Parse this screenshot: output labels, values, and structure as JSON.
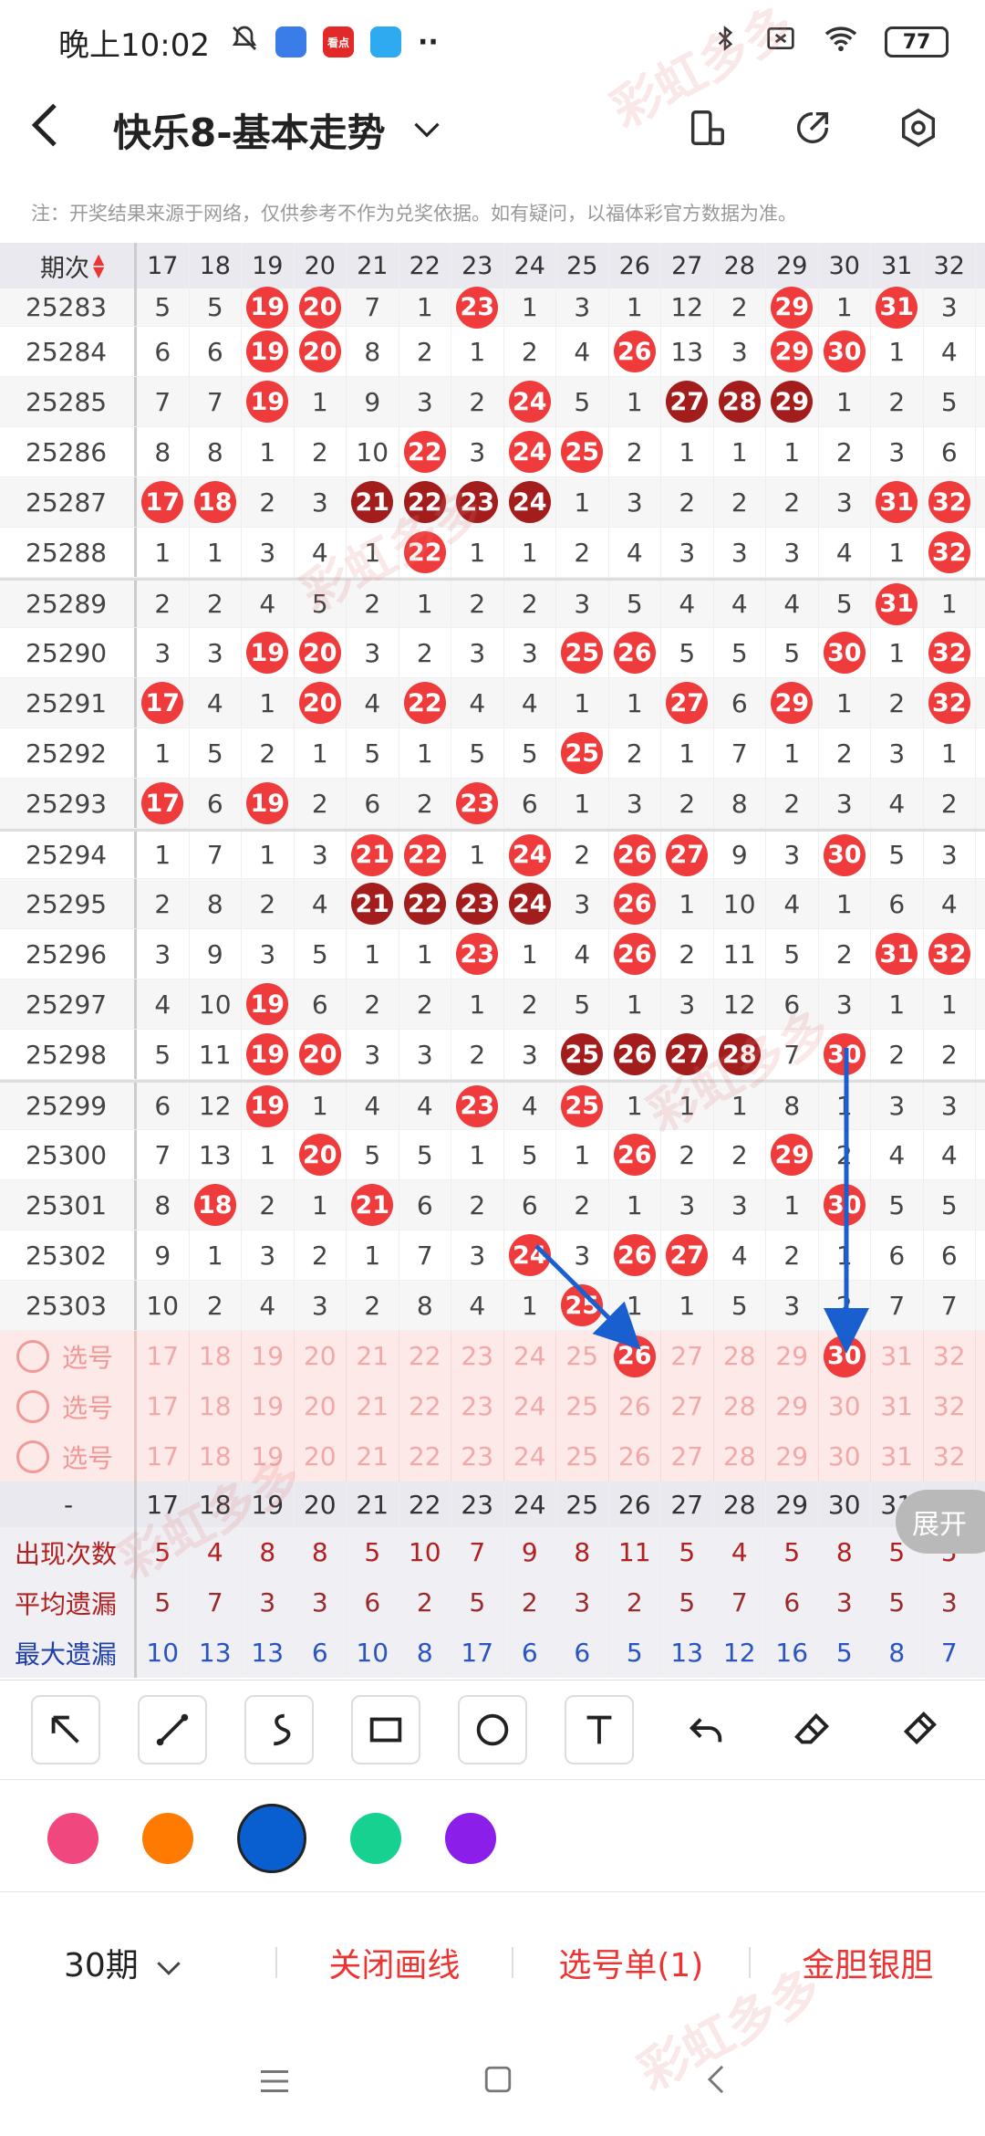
{
  "status": {
    "time": "晚上10:02",
    "battery": "77",
    "app_badge": "看点"
  },
  "header": {
    "title": "快乐8-基本走势"
  },
  "notice": "注：开奖结果来源于网络，仅供参考不作为兑奖依据。如有疑问，以福体彩官方数据为准。",
  "grid": {
    "period_header": "期次",
    "columns": [
      "17",
      "18",
      "19",
      "20",
      "21",
      "22",
      "23",
      "24",
      "25",
      "26",
      "27",
      "28",
      "29",
      "30",
      "31",
      "32"
    ],
    "rows": [
      {
        "period": "25283",
        "cells": [
          "5",
          "5",
          "R19",
          "R20",
          "7",
          "1",
          "R23",
          "1",
          "3",
          "1",
          "12",
          "2",
          "R29",
          "1",
          "R31",
          "3"
        ]
      },
      {
        "period": "25284",
        "cells": [
          "6",
          "6",
          "R19",
          "R20",
          "8",
          "2",
          "1",
          "2",
          "4",
          "R26",
          "13",
          "3",
          "R29",
          "R30",
          "1",
          "4"
        ]
      },
      {
        "period": "25285",
        "cells": [
          "7",
          "7",
          "R19",
          "1",
          "9",
          "3",
          "2",
          "R24",
          "5",
          "1",
          "D27",
          "D28",
          "D29",
          "1",
          "2",
          "5"
        ]
      },
      {
        "period": "25286",
        "cells": [
          "8",
          "8",
          "1",
          "2",
          "10",
          "R22",
          "3",
          "R24",
          "R25",
          "2",
          "1",
          "1",
          "1",
          "2",
          "3",
          "6"
        ]
      },
      {
        "period": "25287",
        "cells": [
          "R17",
          "R18",
          "2",
          "3",
          "D21",
          "D22",
          "D23",
          "D24",
          "1",
          "3",
          "2",
          "2",
          "2",
          "3",
          "R31",
          "R32"
        ]
      },
      {
        "period": "25288",
        "cells": [
          "1",
          "1",
          "3",
          "4",
          "1",
          "R22",
          "1",
          "1",
          "2",
          "4",
          "3",
          "3",
          "3",
          "4",
          "1",
          "R32"
        ]
      },
      {
        "period": "25289",
        "cells": [
          "2",
          "2",
          "4",
          "5",
          "2",
          "1",
          "2",
          "2",
          "3",
          "5",
          "4",
          "4",
          "4",
          "5",
          "R31",
          "1"
        ]
      },
      {
        "period": "25290",
        "cells": [
          "3",
          "3",
          "R19",
          "R20",
          "3",
          "2",
          "3",
          "3",
          "R25",
          "R26",
          "5",
          "5",
          "5",
          "R30",
          "1",
          "R32"
        ]
      },
      {
        "period": "25291",
        "cells": [
          "R17",
          "4",
          "1",
          "R20",
          "4",
          "R22",
          "4",
          "4",
          "1",
          "1",
          "R27",
          "6",
          "R29",
          "1",
          "2",
          "R32"
        ]
      },
      {
        "period": "25292",
        "cells": [
          "1",
          "5",
          "2",
          "1",
          "5",
          "1",
          "5",
          "5",
          "R25",
          "2",
          "1",
          "7",
          "1",
          "2",
          "3",
          "1"
        ]
      },
      {
        "period": "25293",
        "cells": [
          "R17",
          "6",
          "R19",
          "2",
          "6",
          "2",
          "R23",
          "6",
          "1",
          "3",
          "2",
          "8",
          "2",
          "3",
          "4",
          "2"
        ]
      },
      {
        "period": "25294",
        "cells": [
          "1",
          "7",
          "1",
          "3",
          "R21",
          "R22",
          "1",
          "R24",
          "2",
          "R26",
          "R27",
          "9",
          "3",
          "R30",
          "5",
          "3"
        ]
      },
      {
        "period": "25295",
        "cells": [
          "2",
          "8",
          "2",
          "4",
          "D21",
          "D22",
          "D23",
          "D24",
          "3",
          "R26",
          "1",
          "10",
          "4",
          "1",
          "6",
          "4"
        ]
      },
      {
        "period": "25296",
        "cells": [
          "3",
          "9",
          "3",
          "5",
          "1",
          "1",
          "R23",
          "1",
          "4",
          "R26",
          "2",
          "11",
          "5",
          "2",
          "R31",
          "R32"
        ]
      },
      {
        "period": "25297",
        "cells": [
          "4",
          "10",
          "R19",
          "6",
          "2",
          "2",
          "1",
          "2",
          "5",
          "1",
          "3",
          "12",
          "6",
          "3",
          "1",
          "1"
        ]
      },
      {
        "period": "25298",
        "cells": [
          "5",
          "11",
          "R19",
          "R20",
          "3",
          "3",
          "2",
          "3",
          "D25",
          "D26",
          "D27",
          "D28",
          "7",
          "R30",
          "2",
          "2"
        ]
      },
      {
        "period": "25299",
        "cells": [
          "6",
          "12",
          "R19",
          "1",
          "4",
          "4",
          "R23",
          "4",
          "R25",
          "1",
          "1",
          "1",
          "8",
          "1",
          "3",
          "3"
        ]
      },
      {
        "period": "25300",
        "cells": [
          "7",
          "13",
          "1",
          "R20",
          "5",
          "5",
          "1",
          "5",
          "1",
          "R26",
          "2",
          "2",
          "R29",
          "2",
          "4",
          "4"
        ]
      },
      {
        "period": "25301",
        "cells": [
          "8",
          "R18",
          "2",
          "1",
          "R21",
          "6",
          "2",
          "6",
          "2",
          "1",
          "3",
          "3",
          "1",
          "R30",
          "5",
          "5"
        ]
      },
      {
        "period": "25302",
        "cells": [
          "9",
          "1",
          "3",
          "2",
          "1",
          "7",
          "3",
          "R24",
          "3",
          "R26",
          "R27",
          "4",
          "2",
          "1",
          "6",
          "6"
        ]
      },
      {
        "period": "25303",
        "cells": [
          "10",
          "2",
          "4",
          "3",
          "2",
          "8",
          "4",
          "1",
          "R25",
          "1",
          "1",
          "5",
          "3",
          "2",
          "7",
          "7"
        ]
      }
    ],
    "select_label": "选号",
    "select_rows": [
      [
        "17",
        "18",
        "19",
        "20",
        "21",
        "22",
        "23",
        "24",
        "25",
        "R26",
        "27",
        "28",
        "29",
        "R30",
        "31",
        "32"
      ],
      [
        "17",
        "18",
        "19",
        "20",
        "21",
        "22",
        "23",
        "24",
        "25",
        "26",
        "27",
        "28",
        "29",
        "30",
        "31",
        "32"
      ],
      [
        "17",
        "18",
        "19",
        "20",
        "21",
        "22",
        "23",
        "24",
        "25",
        "26",
        "27",
        "28",
        "29",
        "30",
        "31",
        "32"
      ]
    ],
    "num_row_label": "-"
  },
  "stats": [
    {
      "label": "出现次数",
      "values": [
        "5",
        "4",
        "8",
        "8",
        "5",
        "10",
        "7",
        "9",
        "8",
        "11",
        "5",
        "4",
        "5",
        "8",
        "5",
        "5"
      ]
    },
    {
      "label": "平均遗漏",
      "values": [
        "5",
        "7",
        "3",
        "3",
        "6",
        "2",
        "5",
        "2",
        "3",
        "2",
        "5",
        "7",
        "6",
        "3",
        "5",
        "3"
      ]
    },
    {
      "label": "最大遗漏",
      "values": [
        "10",
        "13",
        "13",
        "6",
        "10",
        "8",
        "17",
        "6",
        "6",
        "5",
        "13",
        "12",
        "16",
        "5",
        "8",
        "7"
      ]
    }
  ],
  "expand_label": "展开",
  "colors": [
    "#f0487e",
    "#ff7a00",
    "#0a5fd0",
    "#16d18f",
    "#8b1ee8"
  ],
  "selected_color": "#0a5fd0",
  "bottom": {
    "periods": "30期",
    "close_draw": "关闭画线",
    "select_list": "选号单(1)",
    "gold_silver": "金胆银胆"
  },
  "watermark": "彩虹多多"
}
